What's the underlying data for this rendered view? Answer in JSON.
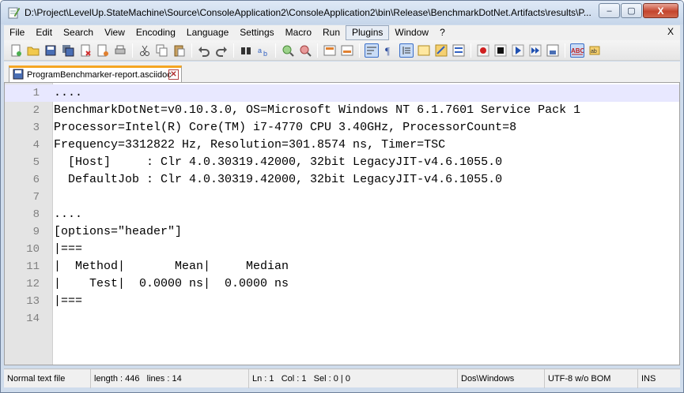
{
  "window": {
    "title": "D:\\Project\\LevelUp.StateMachine\\Source\\ConsoleApplication2\\ConsoleApplication2\\bin\\Release\\BenchmarkDotNet.Artifacts\\results\\P...",
    "minimize": "‒",
    "maximize": "▢",
    "close": "X"
  },
  "menu": {
    "items": [
      "File",
      "Edit",
      "Search",
      "View",
      "Encoding",
      "Language",
      "Settings",
      "Macro",
      "Run",
      "Plugins",
      "Window",
      "?"
    ],
    "active": "Plugins",
    "close": "X"
  },
  "toolbar": {
    "icons": [
      "new-file-icon",
      "open-file-icon",
      "save-icon",
      "save-all-icon",
      "close-icon",
      "close-all-icon",
      "print-icon",
      "cut-icon",
      "copy-icon",
      "paste-icon",
      "undo-icon",
      "redo-icon",
      "find-icon",
      "replace-icon",
      "zoom-in-icon",
      "zoom-out-icon",
      "sync-vertical-icon",
      "sync-horizontal-icon",
      "word-wrap-icon",
      "show-all-chars-icon",
      "indent-guide-icon",
      "user-lang-icon",
      "doc-map-icon",
      "function-list-icon",
      "record-macro-icon",
      "stop-record-icon",
      "play-macro-icon",
      "run-macro-multiple-icon",
      "save-macro-icon",
      "spell-check-icon",
      "spell-next-icon"
    ]
  },
  "tab": {
    "label": "ProgramBenchmarker-report.asciidoc",
    "close": "✕"
  },
  "editor": {
    "lines": [
      {
        "n": "1",
        "text": "...."
      },
      {
        "n": "2",
        "text": "BenchmarkDotNet=v0.10.3.0, OS=Microsoft Windows NT 6.1.7601 Service Pack 1"
      },
      {
        "n": "3",
        "text": "Processor=Intel(R) Core(TM) i7-4770 CPU 3.40GHz, ProcessorCount=8"
      },
      {
        "n": "4",
        "text": "Frequency=3312822 Hz, Resolution=301.8574 ns, Timer=TSC"
      },
      {
        "n": "5",
        "text": "  [Host]     : Clr 4.0.30319.42000, 32bit LegacyJIT-v4.6.1055.0"
      },
      {
        "n": "6",
        "text": "  DefaultJob : Clr 4.0.30319.42000, 32bit LegacyJIT-v4.6.1055.0"
      },
      {
        "n": "7",
        "text": ""
      },
      {
        "n": "8",
        "text": "...."
      },
      {
        "n": "9",
        "text": "[options=\"header\"]"
      },
      {
        "n": "10",
        "text": "|==="
      },
      {
        "n": "11",
        "text": "|  Method|       Mean|     Median"
      },
      {
        "n": "12",
        "text": "|    Test|  0.0000 ns|  0.0000 ns"
      },
      {
        "n": "13",
        "text": "|==="
      },
      {
        "n": "14",
        "text": ""
      }
    ]
  },
  "status": {
    "file_type": "Normal text file",
    "length": "length : 446",
    "lines": "lines : 14",
    "ln": "Ln : 1",
    "col": "Col : 1",
    "sel": "Sel : 0 | 0",
    "eol": "Dos\\Windows",
    "encoding": "UTF-8 w/o BOM",
    "mode": "INS"
  }
}
